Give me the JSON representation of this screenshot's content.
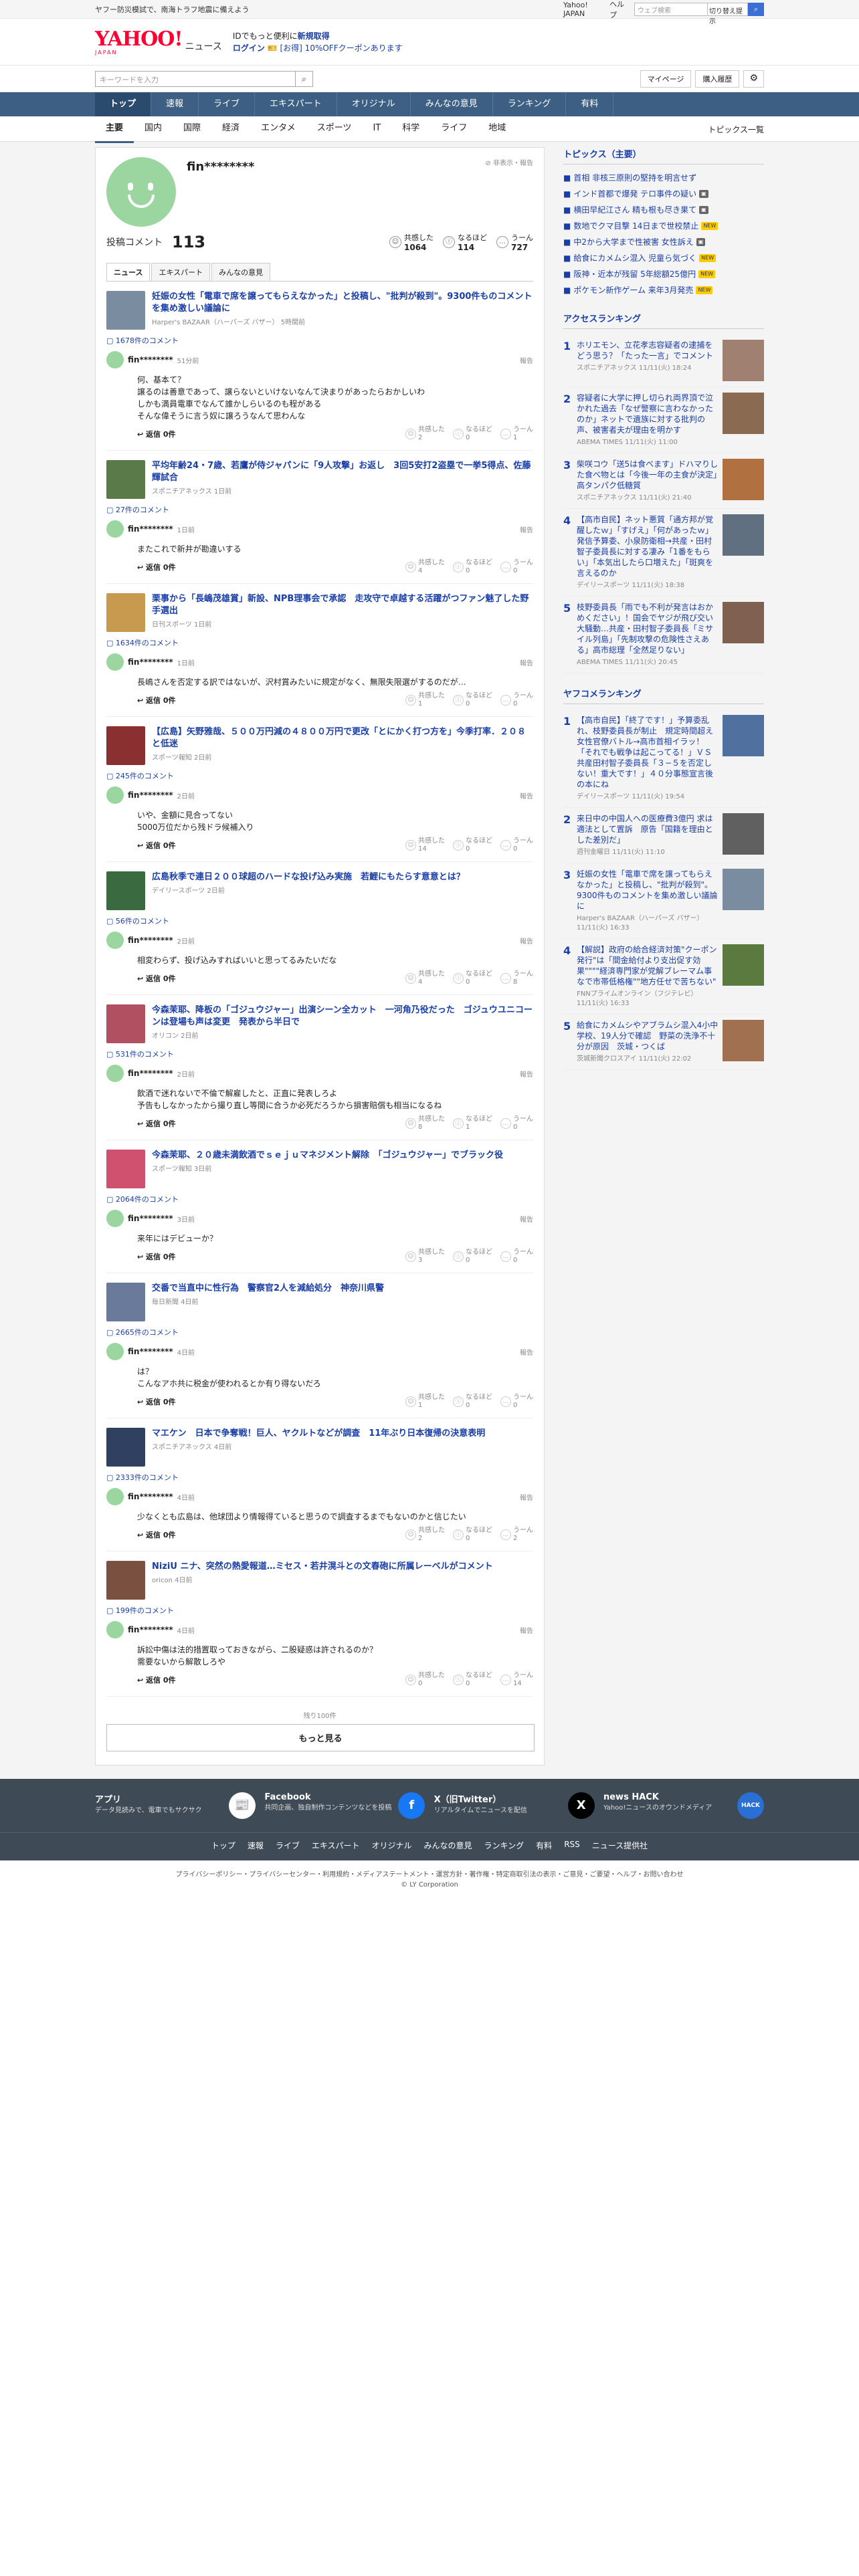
{
  "topbar": {
    "notice": "ヤフー防災模試で、南海トラフ地震に備えよう",
    "links": [
      "Yahoo! JAPAN",
      "ヘルプ"
    ],
    "search_placeholder": "ウェブ検索",
    "switch_label": "切り替え提示"
  },
  "header": {
    "logo": "YAHOO!",
    "logo_sub": "JAPAN",
    "logo_news": "ニュース",
    "promo_line1_pre": "IDでもっと便利に",
    "promo_line1_link": "新規取得",
    "promo_login": "ログイン",
    "promo_coupon": "[お得] 10%OFFクーポンあります"
  },
  "search": {
    "placeholder": "キーワードを入力",
    "mypage": "マイページ",
    "history": "購入履歴"
  },
  "nav": [
    "トップ",
    "速報",
    "ライブ",
    "エキスパート",
    "オリジナル",
    "みんなの意見",
    "ランキング",
    "有料"
  ],
  "subnav": [
    "主要",
    "国内",
    "国際",
    "経済",
    "エンタメ",
    "スポーツ",
    "IT",
    "科学",
    "ライフ",
    "地域"
  ],
  "subnav_all": "トピックス一覧",
  "profile": {
    "name": "fin********",
    "hide_report": "非表示・報告",
    "posted_label": "投稿コメント",
    "posted_count": "113",
    "reactions": [
      {
        "icon": "empathy-icon",
        "label": "共感した",
        "value": "1064"
      },
      {
        "icon": "insight-icon",
        "label": "なるほど",
        "value": "114"
      },
      {
        "icon": "hmm-icon",
        "label": "うーん",
        "value": "727"
      }
    ]
  },
  "tabs": [
    "ニュース",
    "エキスパート",
    "みんなの意見"
  ],
  "reaction_labels": [
    "共感した",
    "なるほど",
    "うーん"
  ],
  "reply_label": "返信 0件",
  "report_label": "報告",
  "entries": [
    {
      "color": "#7a8da0",
      "title": "妊娠の女性「電車で席を譲ってもらえなかった」と投稿し、\"批判が殺到\"。9300件ものコメントを集め激しい議論に",
      "source": "Harper's BAZAAR（ハーパーズ バザー） 5時間前",
      "count": "1678件のコメント",
      "user": "fin********",
      "time": "51分前",
      "text": "何、基本て？\n譲るのは善意であって、譲らないといけないなんて決まりがあったらおかしいわ\nしかも満員電車でなんて誰かしらいるのも程がある\nそんな偉そうに言う奴に譲ろうなんて思わんな",
      "reacts": [
        "2",
        "0",
        "1"
      ]
    },
    {
      "color": "#5a7a4a",
      "title": "平均年齢24・7歳、若鷹が侍ジャパンに「9人攻撃」お返し　3回5安打2盗塁で一挙5得点、佐藤輝試合",
      "source": "スポニチアネックス 1日前",
      "count": "27件のコメント",
      "user": "fin********",
      "time": "1日前",
      "text": "またこれで新井が勘違いする",
      "reacts": [
        "4",
        "0",
        "0"
      ]
    },
    {
      "color": "#c89a50",
      "title": "栗事から「長嶋茂雄賞」新設、NPB理事会で承認　走攻守で卓越する活躍がつファン魅了した野手選出",
      "source": "日刊スポーツ 1日前",
      "count": "1634件のコメント",
      "user": "fin********",
      "time": "1日前",
      "text": "長嶋さんを否定する訳ではないが、沢村賞みたいに規定がなく、無限失限選がするのだが…",
      "reacts": [
        "1",
        "0",
        "0"
      ]
    },
    {
      "color": "#8a3030",
      "title": "【広島】矢野雅哉、５００万円減の４８００万円で更改「とにかく打つ方を」今季打率．２０８と低迷",
      "source": "スポーツ報知 2日前",
      "count": "245件のコメント",
      "user": "fin********",
      "time": "2日前",
      "text": "いや、金額に見合ってない\n5000万位だから残ドラ候補入り",
      "reacts": [
        "14",
        "0",
        "0"
      ]
    },
    {
      "color": "#3a6a40",
      "title": "広島秋季で連日２００球超のハードな投げ込み実施　若鯉にもたらす意意とは？",
      "source": "デイリースポーツ 2日前",
      "count": "56件のコメント",
      "user": "fin********",
      "time": "2日前",
      "text": "相変わらず、投げ込みすればいいと思ってるみたいだな",
      "reacts": [
        "4",
        "0",
        "8"
      ]
    },
    {
      "color": "#b05060",
      "title": "今森茉耶、降板の「ゴジュウジャー」出演シーン全カット　一河角乃役だった　ゴジュウユニコーンは登場も声は変更　発表から半日で",
      "source": "オリコン 2日前",
      "count": "531件のコメント",
      "user": "fin********",
      "time": "2日前",
      "text": "飲酒で迷れないで不倫で解雇したと、正直に発表しろよ\n予告もしなかったから撮り直し等間に合うか必死だろうから損害賠償も相当になるね",
      "reacts": [
        "8",
        "1",
        "0"
      ]
    },
    {
      "color": "#d05070",
      "title": "今森茉耶、２０歳未満飲酒でｓｅｊｕマネジメント解除　「ゴジュウジャー」でブラック役",
      "source": "スポーツ報知 3日前",
      "count": "2064件のコメント",
      "user": "fin********",
      "time": "3日前",
      "text": "来年にはデビューか？",
      "reacts": [
        "3",
        "0",
        "0"
      ]
    },
    {
      "color": "#6a7a9a",
      "title": "交番で当直中に性行為　警察官2人を減給処分　神奈川県警",
      "source": "毎日新聞 4日前",
      "count": "2665件のコメント",
      "user": "fin********",
      "time": "4日前",
      "text": "は？\nこんなアホ共に税金が使われるとか有り得ないだろ",
      "reacts": [
        "1",
        "0",
        "0"
      ]
    },
    {
      "color": "#304060",
      "title": "マエケン　日本で争奪戦！巨人、ヤクルトなどが調査　11年ぶり日本復帰の決意表明",
      "source": "スポニチアネックス 4日前",
      "count": "2333件のコメント",
      "user": "fin********",
      "time": "4日前",
      "text": "少なくとも広島は、他球団より情報得ていると思うので調査するまでもないのかと信じたい",
      "reacts": [
        "2",
        "0",
        "2"
      ]
    },
    {
      "color": "#7a5040",
      "title": "NiziU ニナ、突然の熱愛報道…ミセス・若井滉斗との文春砲に所属レーベルがコメント",
      "source": "oricon 4日前",
      "count": "199件のコメント",
      "user": "fin********",
      "time": "4日前",
      "text": "訴訟中傷は法的措置取っておきながら、二股疑惑は許されるのか？\n需要ないから解散しろや",
      "reacts": [
        "0",
        "0",
        "14"
      ]
    }
  ],
  "more": {
    "rest": "残り100件",
    "label": "もっと見る"
  },
  "sidebar": {
    "topics_title": "トピックス（主要）",
    "topics": [
      {
        "text": "首相 非核三原則の堅持を明言せず",
        "badge": ""
      },
      {
        "text": "インド首都で爆発 テロ事件の疑い",
        "badge": "camera-icon"
      },
      {
        "text": "横田早紀江さん 精も根も尽き果て",
        "badge": "camera-icon"
      },
      {
        "text": "数地でクマ目撃 14日まで世校禁止",
        "badge": "NEW"
      },
      {
        "text": "中2から大学まで性被害 女性訴え",
        "badge": "camera-icon"
      },
      {
        "text": "給食にカメムシ混入 児童ら気づく",
        "badge": "NEW"
      },
      {
        "text": "阪神・近本が残留 5年総額25億円",
        "badge": "NEW"
      },
      {
        "text": "ポケモン新作ゲーム 来年3月発売",
        "badge": "NEW"
      }
    ],
    "access_title": "アクセスランキング",
    "access": [
      {
        "n": "1",
        "color": "#a08070",
        "title": "ホリエモン、立花孝志容疑者の逮捕をどう思う？「たった一言」でコメント",
        "src": "スポニチアネックス 11/11(火) 18:24"
      },
      {
        "n": "2",
        "color": "#8a6a50",
        "title": "容疑者に大学に押し切られ両界頂で泣かれた過去「なぜ警察に言わなかったのか」ネットで遺族に対する批判の声、被害者夫が理由を明かす",
        "src": "ABEMA TIMES 11/11(火) 11:00"
      },
      {
        "n": "3",
        "color": "#b07040",
        "title": "柴咲コウ「送5は食べます」ドハマりした食べ物とは「今後一年の主食が決定」高タンパク低糖質",
        "src": "スポニチアネックス 11/11(火) 21:40"
      },
      {
        "n": "4",
        "color": "#607080",
        "title": "【高市自民】ネット悪質「通方邦が覚醒したｗ」「すげえ」「何があったｗ」発信予算委、小泉防衛相→共産・田村智子委員長に対する凄み「1番をもらい」「本気出したら口増えた」「斑爽を言えるのか",
        "src": "デイリースポーツ 11/11(火) 18:38"
      },
      {
        "n": "5",
        "color": "#806050",
        "title": "枝野委員長「雨でも不利が発言はおかめください」！国会でヤジが飛び交い大騒動…共産・田村智子委員長「ミサイル列島」「先制攻撃の危険性さえある」高市総理「全然足りない」",
        "src": "ABEMA TIMES 11/11(火) 20:45"
      }
    ],
    "comment_title": "ヤフコメランキング",
    "comments": [
      {
        "n": "1",
        "color": "#5070a0",
        "title": "【高市自民】「終了です！」予算委乱れ、枝野委員長が制止　規定時間超え女性官僚バトル→高市首相イラッ！「それでも戦争は起こってる！」ＶＳ共産田村智子委員長「３−５を否定しない！重大です！」４０分事態宣言後の本にね",
        "src": "デイリースポーツ 11/11(火) 19:54"
      },
      {
        "n": "2",
        "color": "#606060",
        "title": "来日中の中国人への医療費3億円 求は適法として置訴　原告「国籍を理由とした差別だ」",
        "src": "週刊金曜日 11/11(火) 11:10"
      },
      {
        "n": "3",
        "color": "#7a8da0",
        "title": "妊娠の女性「電車で席を譲ってもらえなかった」と投稿し、\"批判が殺到\"。9300件ものコメントを集め激しい議論に",
        "src": "Harper's BAZAAR（ハーパーズ バザー） 11/11(火) 16:33"
      },
      {
        "n": "4",
        "color": "#5a7a40",
        "title": "【解説】政府の給合経済対策\"クーポン発行\"は「間金給付より支出促す効果\"\"\"\"経済専門家が党解ブレーマム事なで市帯低格権\"\"地方任せで苦ちない\"",
        "src": "FNNプライムオンライン（フジテレビ） 11/11(火) 16:33"
      },
      {
        "n": "5",
        "color": "#a07050",
        "title": "給食にカメムシやアブラムシ混入4小中学校、19人分で確認　野菜の洗浄不十分が原因　茨城・つくば",
        "src": "茨城新聞クロスアイ 11/11(火) 22:02"
      }
    ]
  },
  "footer": {
    "apps": [
      {
        "title": "アプリ",
        "desc": "データ見読みで、電車でもサクサク",
        "icon": "app-icon",
        "icon_text": "📰",
        "bg": "#ffffff",
        "fg": "#333333"
      },
      {
        "title": "Facebook",
        "desc": "共同企画、独自制作コンテンツなどを投稿",
        "icon": "facebook-icon",
        "icon_text": "f",
        "bg": "#1877f2",
        "fg": "#ffffff"
      },
      {
        "title": "X（旧Twitter）",
        "desc": "リアルタイムでニュースを配信",
        "icon": "x-icon",
        "icon_text": "X",
        "bg": "#000000",
        "fg": "#ffffff"
      },
      {
        "title": "news HACK",
        "desc": "Yahoo!ニュースのオウンドメディア",
        "icon": "newshack-icon",
        "icon_text": "HACK",
        "bg": "#2a6fd4",
        "fg": "#ffffff"
      }
    ],
    "nav": [
      "トップ",
      "速報",
      "ライブ",
      "エキスパート",
      "オリジナル",
      "みんなの意見",
      "ランキング",
      "有料",
      "RSS",
      "ニュース提供社"
    ],
    "links": "プライバシーポリシー・プライバシーセンター・利用規約・メディアステートメント・運営方針・著作権・特定商取引法の表示・ご意見・ご要望・ヘルプ・お問い合わせ",
    "copyright": "© LY Corporation"
  }
}
